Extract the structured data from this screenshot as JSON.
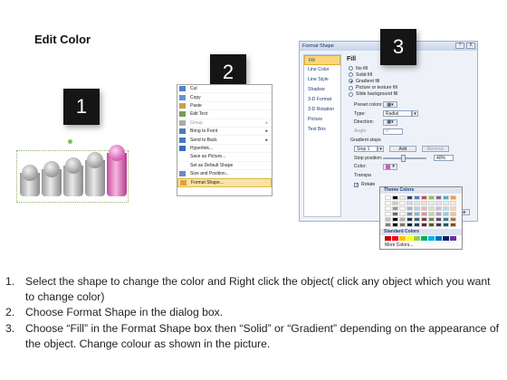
{
  "title": "Edit Color",
  "badges": [
    "1",
    "2",
    "3"
  ],
  "context_menu": {
    "items": [
      {
        "label": "Cut",
        "state": "normal",
        "icon": "scissors-icon"
      },
      {
        "label": "Copy",
        "state": "normal",
        "icon": "copy-icon"
      },
      {
        "label": "Paste",
        "state": "normal",
        "icon": "paste-icon"
      },
      {
        "label": "Edit Text",
        "state": "normal",
        "icon": "edit-text-icon"
      },
      {
        "label": "Group",
        "state": "disabled",
        "icon": "group-icon",
        "submenu": true
      },
      {
        "label": "Bring to Front",
        "state": "normal",
        "icon": "bring-front-icon",
        "submenu": true
      },
      {
        "label": "Send to Back",
        "state": "normal",
        "icon": "send-back-icon",
        "submenu": true
      },
      {
        "label": "Hyperlink...",
        "state": "normal",
        "icon": "hyperlink-icon"
      },
      {
        "label": "Save as Picture...",
        "state": "normal",
        "icon": ""
      },
      {
        "label": "Set as Default Shape",
        "state": "normal",
        "icon": ""
      },
      {
        "label": "Size and Position...",
        "state": "normal",
        "icon": "size-icon"
      },
      {
        "label": "Format Shape...",
        "state": "highlighted",
        "icon": "format-shape-icon"
      }
    ]
  },
  "dialog": {
    "title": "Format Shape",
    "help_btn": "?",
    "close_btn": "X",
    "nav": [
      "Fill",
      "Line Color",
      "Line Style",
      "Shadow",
      "3-D Format",
      "3-D Rotation",
      "Picture",
      "Text Box"
    ],
    "section": "Fill",
    "fill_options": [
      {
        "label": "No fill",
        "selected": false
      },
      {
        "label": "Solid fill",
        "selected": false
      },
      {
        "label": "Gradient fill",
        "selected": true
      },
      {
        "label": "Picture or texture fill",
        "selected": false
      },
      {
        "label": "Slide background fill",
        "selected": false
      }
    ],
    "preset_colors_label": "Preset colors:",
    "type_label": "Type:",
    "type_value": "Radial",
    "direction_label": "Direction:",
    "angle_label": "Angle:",
    "angle_value": "0°",
    "gradient_stops_label": "Gradient stops",
    "stop_value": "Stop 1",
    "add_btn": "Add",
    "remove_btn": "Remove",
    "stop_position_label": "Stop position:",
    "stop_position_value": "40%",
    "color_label": "Color:",
    "transparency_label": "Transpa",
    "rotate_label": "Rotate",
    "close_label": "Close"
  },
  "picker": {
    "theme_label": "Theme Colors",
    "standard_label": "Standard Colors",
    "more_label": "More Colors...",
    "theme_top": [
      "#ffffff",
      "#000000",
      "#eeece1",
      "#1f497d",
      "#4f81bd",
      "#c0504d",
      "#9bbb59",
      "#8064a2",
      "#4bacc6",
      "#f79646"
    ],
    "standard": [
      "#c00000",
      "#ff0000",
      "#ffc000",
      "#ffff00",
      "#92d050",
      "#00b050",
      "#00b0f0",
      "#0070c0",
      "#002060",
      "#7030a0"
    ]
  },
  "steps": [
    {
      "num": "1.",
      "text": "Select the shape to change the color and Right click the object( click any object which you want to change color)"
    },
    {
      "num": "2.",
      "text": "Choose Format Shape in the dialog box."
    },
    {
      "num": "3.",
      "text": "Choose “Fill” in the Format Shape box then “Solid” or “Gradient” depending on the appearance of the object. Change colour as shown in the picture."
    }
  ]
}
